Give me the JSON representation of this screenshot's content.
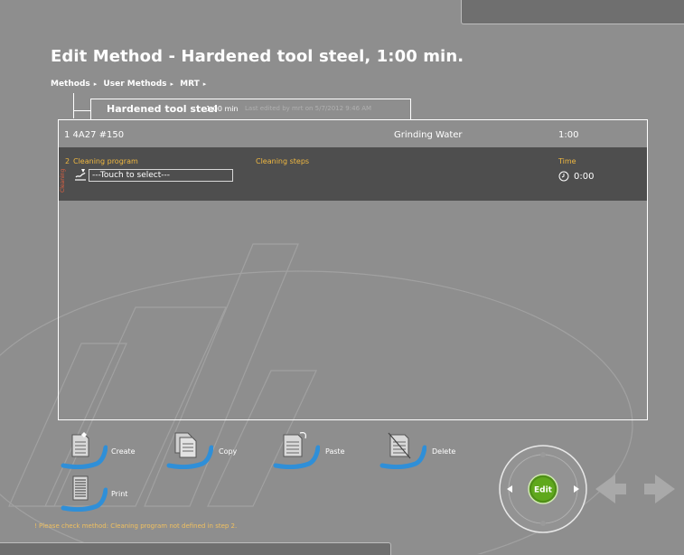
{
  "title": "Edit Method - Hardened tool steel, 1:00 min.",
  "breadcrumb": [
    "Methods",
    "User Methods",
    "MRT"
  ],
  "breadcrumb_sep": "▸",
  "method_tab": {
    "name": "Hardened tool steel",
    "time": "1:00 min",
    "edited": "Last edited by mrt on 5/7/2012 9:46 AM"
  },
  "steps": [
    {
      "label": "1  4A27 #150",
      "surface": "Grinding Water",
      "time": "1:00"
    }
  ],
  "cleaning_step": {
    "number": "2",
    "vertical_label": "Cleaning",
    "col_program": "Cleaning program",
    "col_steps": "Cleaning steps",
    "col_time": "Time",
    "select_placeholder": "---Touch to select---",
    "time_value": "0:00"
  },
  "toolbar": {
    "create": "Create",
    "copy": "Copy",
    "paste": "Paste",
    "delete": "Delete",
    "print": "Print"
  },
  "nav": {
    "edit": "Edit"
  },
  "warning": "! Please check method: Cleaning program not defined in step 2.",
  "colors": {
    "background": "#8e8e8e",
    "accent_orange": "#f0b840",
    "edit_green": "#5fa81c",
    "tool_blue": "#2f8fd8"
  }
}
